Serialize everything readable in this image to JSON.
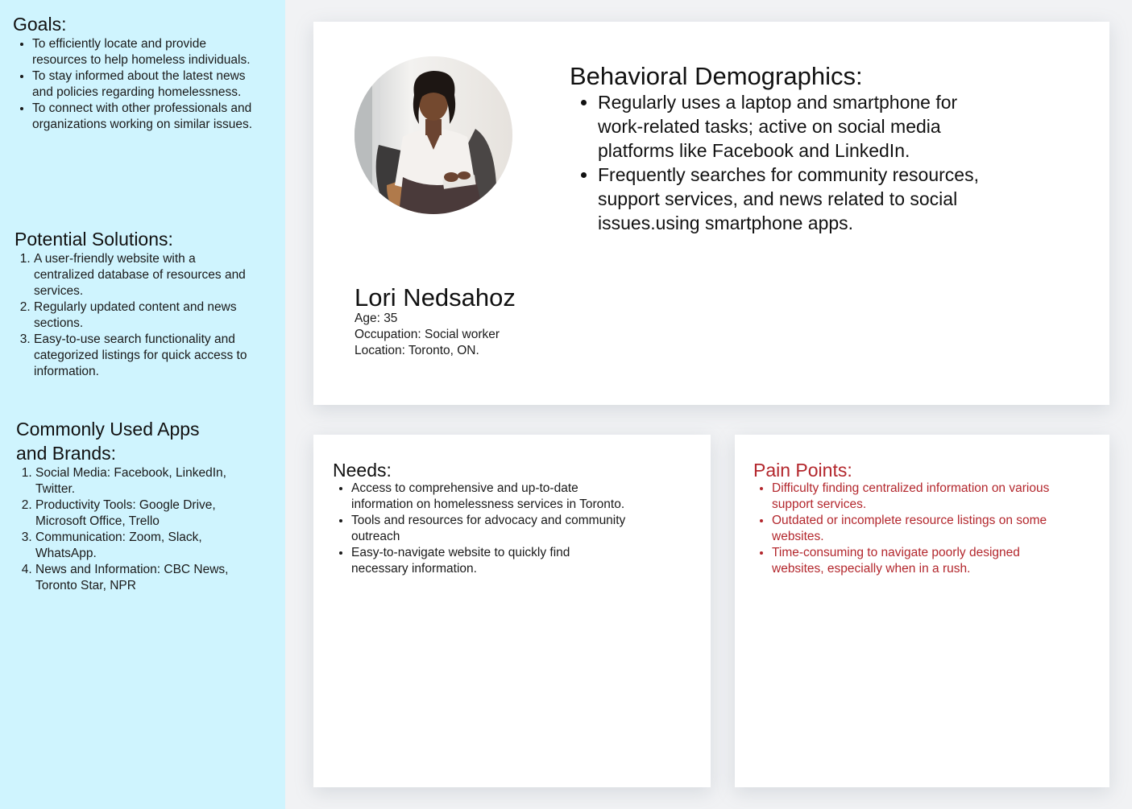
{
  "goals": {
    "title": "Goals:",
    "items": [
      "To efficiently locate and provide resources to help homeless individuals.",
      "To stay informed about the latest news and policies regarding homelessness.",
      "To connect with other professionals and organizations working on similar issues."
    ]
  },
  "solutions": {
    "title": "Potential Solutions:",
    "items": [
      "A user-friendly website with a centralized database of resources and services.",
      "Regularly updated content and news sections.",
      "Easy-to-use search functionality and categorized listings for quick access to information."
    ]
  },
  "apps": {
    "title": "Commonly Used Apps and Brands:",
    "items": [
      "Social Media: Facebook, LinkedIn, Twitter.",
      "Productivity Tools: Google Drive, Microsoft Office, Trello",
      "Communication: Zoom, Slack, WhatsApp.",
      "News and Information: CBC News, Toronto Star, NPR"
    ]
  },
  "persona": {
    "name": "Lori Nedsahoz",
    "age": "Age: 35",
    "occupation": "Occupation: Social worker",
    "location": "Location: Toronto, ON."
  },
  "behavioral": {
    "title": "Behavioral Demographics:",
    "items": [
      "Regularly uses a laptop and smartphone for work-related tasks; active on social media platforms like Facebook and LinkedIn.",
      "Frequently searches for community resources, support services, and news related to social issues.using smartphone apps."
    ]
  },
  "needs": {
    "title": "Needs:",
    "items": [
      "Access to comprehensive and up-to-date information on homelessness services in Toronto.",
      "Tools and resources for advocacy and community outreach",
      "Easy-to-navigate website to quickly find necessary information."
    ]
  },
  "pain_points": {
    "title": "Pain Points:",
    "items": [
      "Difficulty finding centralized information on various support services.",
      "Outdated or incomplete resource listings on some websites.",
      "Time-consuming to navigate poorly designed websites, especially when in a rush."
    ]
  },
  "colors": {
    "sidebar_bg": "#cff4fe",
    "pain_points_accent": "#b3272d",
    "page_bg": "#f1f2f4"
  },
  "icons": {
    "avatar": "persona-photo"
  }
}
